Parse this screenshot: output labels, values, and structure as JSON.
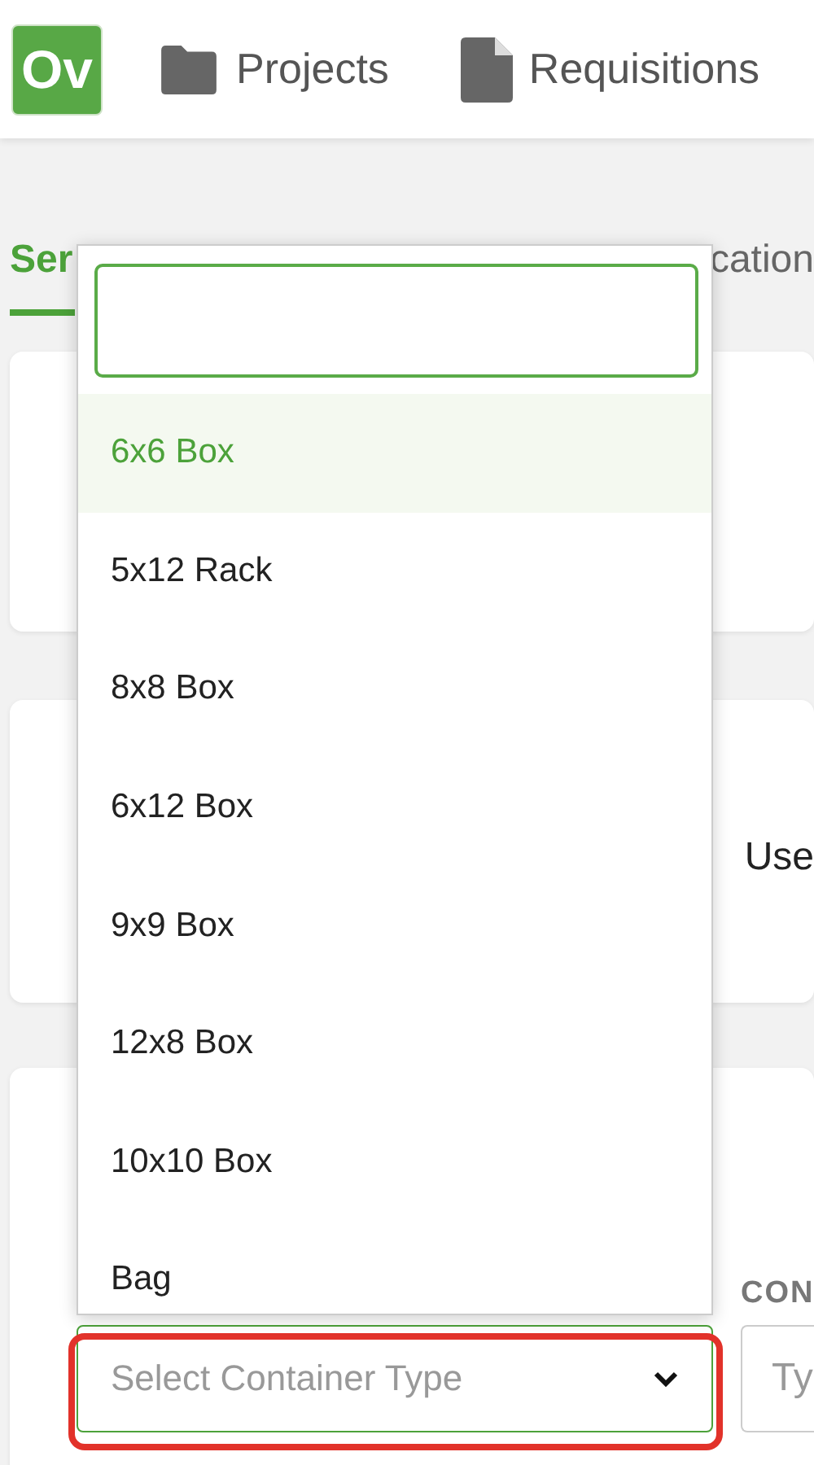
{
  "header": {
    "logo": "Ov",
    "nav": [
      {
        "label": "Projects",
        "kind": "folder"
      },
      {
        "label": "Requisitions",
        "kind": "document"
      }
    ]
  },
  "tabs": [
    {
      "label": "Ser",
      "selected": true
    },
    {
      "label": "cation",
      "selected": false
    }
  ],
  "info_card": {
    "text": "Use"
  },
  "container_card": {
    "select": {
      "placeholder": "Select Container Type",
      "expanded": true,
      "outlined": true
    },
    "column_2": {
      "label": "CON",
      "placeholder": "Ty"
    }
  },
  "dropdown": {
    "options": [
      {
        "label": "6x6 Box",
        "selected": true
      },
      {
        "label": "5x12 Rack",
        "selected": false
      },
      {
        "label": "8x8 Box",
        "selected": false
      },
      {
        "label": "6x12 Box",
        "selected": false
      },
      {
        "label": "9x9 Box",
        "selected": false
      },
      {
        "label": "12x8 Box",
        "selected": false
      },
      {
        "label": "10x10 Box",
        "selected": false
      },
      {
        "label": "Bag",
        "selected": false
      }
    ]
  }
}
